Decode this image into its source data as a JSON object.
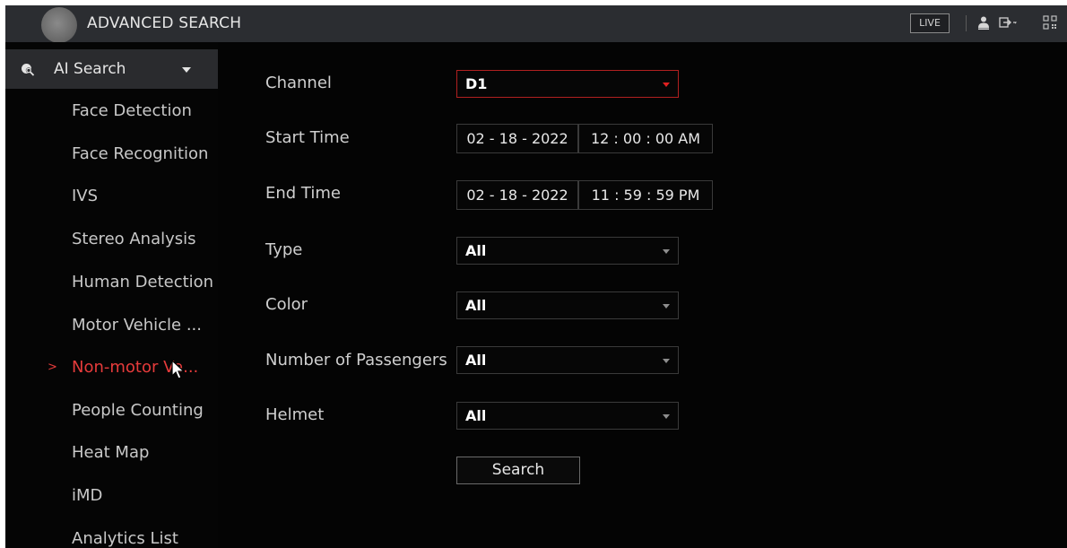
{
  "titlebar": {
    "title": "ADVANCED SEARCH",
    "live_label": "LIVE",
    "icons": [
      "user-icon",
      "logout-icon",
      "qr-code-icon"
    ]
  },
  "sidebar": {
    "header_label": "AI Search",
    "header_icon": "ai-search-icon",
    "items": [
      {
        "label": "Face Detection",
        "active": false
      },
      {
        "label": "Face Recognition",
        "active": false
      },
      {
        "label": "IVS",
        "active": false
      },
      {
        "label": "Stereo Analysis",
        "active": false
      },
      {
        "label": "Human Detection",
        "active": false
      },
      {
        "label": "Motor Vehicle ...",
        "active": false
      },
      {
        "label": "Non-motor Ve...",
        "active": true
      },
      {
        "label": "People Counting",
        "active": false
      },
      {
        "label": "Heat Map",
        "active": false
      },
      {
        "label": "iMD",
        "active": false
      },
      {
        "label": "Analytics List",
        "active": false
      }
    ],
    "active_marker": ">"
  },
  "form": {
    "channel": {
      "label": "Channel",
      "value": "D1"
    },
    "start_time": {
      "label": "Start Time",
      "date": "02 - 18 - 2022",
      "time": "12 : 00 : 00 AM"
    },
    "end_time": {
      "label": "End Time",
      "date": "02 - 18 - 2022",
      "time": "11 : 59 : 59 PM"
    },
    "type": {
      "label": "Type",
      "value": "All"
    },
    "color": {
      "label": "Color",
      "value": "All"
    },
    "passengers": {
      "label": "Number of Passengers",
      "value": "All"
    },
    "helmet": {
      "label": "Helmet",
      "value": "All"
    },
    "search_label": "Search"
  },
  "colors": {
    "accent": "#e63b3b",
    "background": "#040404",
    "titlebar": "#2b2d31"
  }
}
